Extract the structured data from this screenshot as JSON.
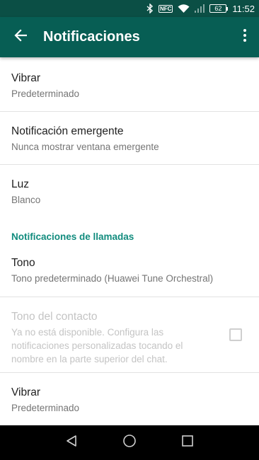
{
  "status_bar": {
    "nfc_label": "NFC",
    "battery": "62",
    "time": "11:52"
  },
  "app_bar": {
    "title": "Notificaciones"
  },
  "items": {
    "vibrate_1": {
      "title": "Vibrar",
      "summary": "Predeterminado"
    },
    "popup": {
      "title": "Notificación emergente",
      "summary": "Nunca mostrar ventana emergente"
    },
    "light": {
      "title": "Luz",
      "summary": "Blanco"
    },
    "call_header": "Notificaciones de llamadas",
    "tone": {
      "title": "Tono",
      "summary": "Tono predeterminado (Huawei Tune Orchestral)"
    },
    "contact_tone": {
      "title": "Tono del contacto",
      "summary": "Ya no está disponible. Configura las notificaciones personalizadas tocando el nombre en la parte superior del chat.",
      "checked": false
    },
    "vibrate_2": {
      "title": "Vibrar",
      "summary": "Predeterminado"
    }
  },
  "colors": {
    "status_bar": "#0b4f45",
    "app_bar": "#075e54",
    "accent": "#128c7e"
  },
  "icons": {
    "back": "arrow-left-icon",
    "more": "more-vert-icon",
    "nav_back": "triangle-back-icon",
    "nav_home": "circle-home-icon",
    "nav_recents": "square-recents-icon"
  }
}
